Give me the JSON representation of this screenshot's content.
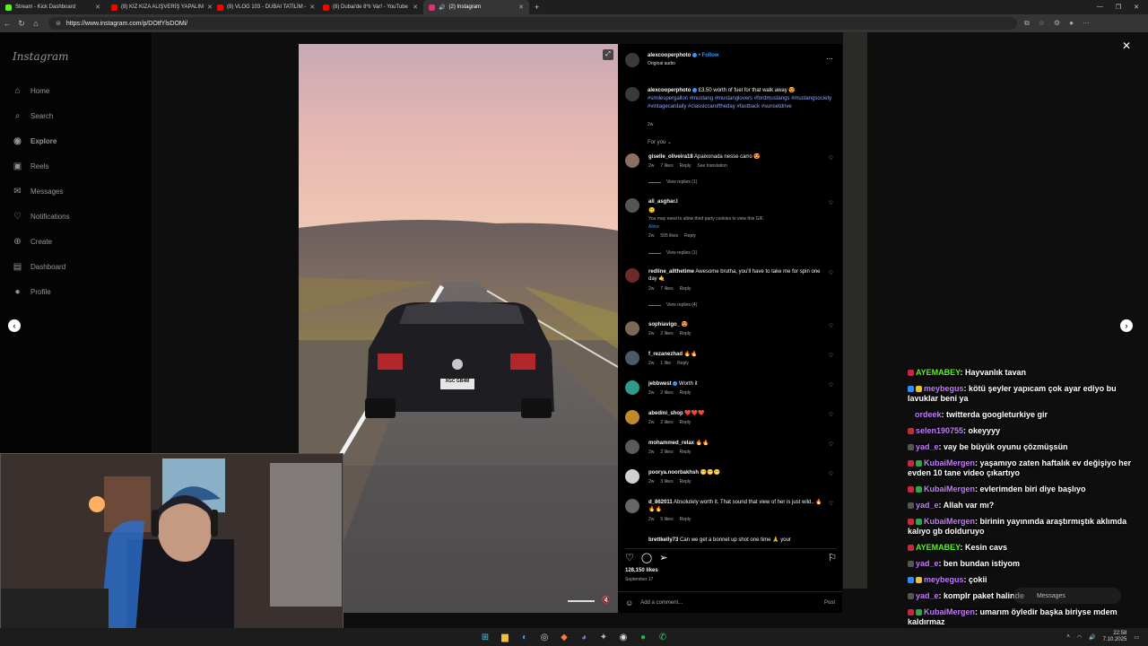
{
  "browser": {
    "tabs": [
      {
        "label": "Stream - Kick Dashboard",
        "color": "#53fc18"
      },
      {
        "label": "(8) KIZ KIZA ALIŞVERİŞ YAPALIM",
        "color": "#ff0000"
      },
      {
        "label": "(8) VLOG 103 - DUBAI TATİLİM -",
        "color": "#ff0000"
      },
      {
        "label": "(8) Dubai'de 8*lı Var! - YouTube",
        "color": "#ff0000"
      },
      {
        "label": "(2) Instagram",
        "color": "#e1306c"
      }
    ],
    "url": "https://www.instagram.com/p/DOtfYlsDOMi/"
  },
  "instagram": {
    "logo": "Instagram",
    "nav": [
      {
        "label": "Home",
        "icon": "home-icon",
        "glyph": "⌂"
      },
      {
        "label": "Search",
        "icon": "search-icon",
        "glyph": "⌕"
      },
      {
        "label": "Explore",
        "icon": "compass-icon",
        "glyph": "◉"
      },
      {
        "label": "Reels",
        "icon": "reels-icon",
        "glyph": "▣"
      },
      {
        "label": "Messages",
        "icon": "messenger-icon",
        "glyph": "✉"
      },
      {
        "label": "Notifications",
        "icon": "heart-icon",
        "glyph": "♡"
      },
      {
        "label": "Create",
        "icon": "plus-icon",
        "glyph": "⊕"
      },
      {
        "label": "Dashboard",
        "icon": "dashboard-icon",
        "glyph": "▤"
      },
      {
        "label": "Profile",
        "icon": "profile-avatar",
        "glyph": "●"
      }
    ]
  },
  "post": {
    "author": "alexcooperphoto",
    "follow": "Follow",
    "audio": "Original audio",
    "caption_user": "alexcooperphoto",
    "caption_text": "£3.50 worth of fuel for that walk away 😍",
    "hashtags": "#smilespergallon #mustang #mustanglovers #fordmustangs #mustangsociety #vintagecardaily #classiccaroftheday #fastback #sunsetdrive",
    "caption_age": "2w",
    "for_you": "For you",
    "likes": "128,150 likes",
    "date": "September 17",
    "add_comment_placeholder": "Add a comment...",
    "post_button": "Post",
    "plate": "XGC GB4M"
  },
  "comments": [
    {
      "user": "giselle_oliveira18",
      "text": "Apaixonada nesse carro 😍",
      "age": "2w",
      "likes": "7 likes",
      "reply": "Reply",
      "extra": "See translation",
      "replies": "View replies (1)"
    },
    {
      "user": "ali_asghar.l",
      "text": "🙂",
      "note": "You may need to allow third party cookies to view this GIF.",
      "allow": "Allow",
      "age": "2w",
      "likes": "595 likes",
      "reply": "Reply",
      "replies": "View replies (1)"
    },
    {
      "user": "redline_allthetime",
      "text": "Awesome brutha, you'll have to take me for spin one day 🤙",
      "age": "2w",
      "likes": "7 likes",
      "reply": "Reply",
      "replies": "View replies (4)"
    },
    {
      "user": "sophiavigo_",
      "text": "😍",
      "age": "2w",
      "likes": "2 likes",
      "reply": "Reply"
    },
    {
      "user": "f_rezanezhad",
      "text": "🔥🔥",
      "age": "2w",
      "likes": "1 like",
      "reply": "Reply"
    },
    {
      "user": "jebbwest",
      "text": "Worth it",
      "age": "2w",
      "likes": "2 likes",
      "reply": "Reply"
    },
    {
      "user": "abedini_shop",
      "text": "❤️❤️❤️",
      "age": "2w",
      "likes": "2 likes",
      "reply": "Reply"
    },
    {
      "user": "mohammed_relax",
      "text": "🔥🔥",
      "age": "2w",
      "likes": "2 likes",
      "reply": "Reply"
    },
    {
      "user": "poorya.noorbakhsh",
      "text": "😁😁😁",
      "age": "2w",
      "likes": "3 likes",
      "reply": "Reply"
    },
    {
      "user": "d_862011",
      "text": "Absolutely worth it. That sound that view of her is just wild.. 🔥🔥🔥",
      "age": "2w",
      "likes": "5 likes",
      "reply": "Reply"
    },
    {
      "user": "brettkelly73",
      "text": "Can we get a bonnet up shot one time 🙏 your"
    }
  ],
  "chat": [
    {
      "user": "AYEMABEY",
      "color": "#53fc18",
      "text": ": Hayvanlık tavan"
    },
    {
      "user": "meybegus",
      "color": "#c77dff",
      "text": ": kötü şeyler yapıcam çok ayar ediyo bu lavuklar beni ya"
    },
    {
      "user": "ordeek",
      "color": "#c77dff",
      "text": ": twitterda googleturkiye gir"
    },
    {
      "user": "selen190755",
      "color": "#c77dff",
      "text": ": okeyyyy"
    },
    {
      "user": "yad_e",
      "color": "#c77dff",
      "text": ": vay be büyük oyunu çözmüşsün"
    },
    {
      "user": "KubaiMergen",
      "color": "#c77dff",
      "text": ": yaşamıyo zaten haftalık ev değişiyo her evden 10 tane video çıkartıyo"
    },
    {
      "user": "KubaiMergen",
      "color": "#c77dff",
      "text": ": evlerimden biri diye başlıyo"
    },
    {
      "user": "yad_e",
      "color": "#c77dff",
      "text": ": Allah var mı?"
    },
    {
      "user": "KubaiMergen",
      "color": "#c77dff",
      "text": ": birinin yayınında araştırmıştık aklımda kalıyo gb dolduruyo"
    },
    {
      "user": "AYEMABEY",
      "color": "#53fc18",
      "text": ": Kesin cavs"
    },
    {
      "user": "yad_e",
      "color": "#c77dff",
      "text": ": ben bundan istiyom"
    },
    {
      "user": "meybegus",
      "color": "#c77dff",
      "text": ": çokii"
    },
    {
      "user": "yad_e",
      "color": "#c77dff",
      "text": ": komplr paket halinde"
    },
    {
      "user": "KubaiMergen",
      "color": "#c77dff",
      "text": ": umarım öyledir başka biriyse mdem kaldırmaz"
    }
  ],
  "messages_bubble": "Messages",
  "taskbar": {
    "time": "22:58",
    "date": "7.10.2025"
  }
}
